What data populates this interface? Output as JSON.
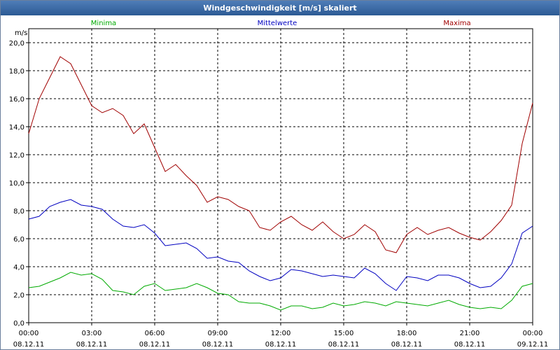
{
  "window": {
    "title": "Windgeschwindigkeit [m/s] skaliert"
  },
  "chart_data": {
    "type": "line",
    "title": "Windgeschwindigkeit [m/s] skaliert",
    "ylabel": "m/s",
    "ylim": [
      0,
      21
    ],
    "xlim": [
      0,
      24
    ],
    "grid": true,
    "y_ticks": [
      "0,0",
      "2,0",
      "4,0",
      "6,0",
      "8,0",
      "10,0",
      "12,0",
      "14,0",
      "16,0",
      "18,0",
      "20,0"
    ],
    "y_tick_values": [
      0,
      2,
      4,
      6,
      8,
      10,
      12,
      14,
      16,
      18,
      20
    ],
    "x_ticks": [
      {
        "time": "00:00",
        "date": "08.12.11"
      },
      {
        "time": "03:00",
        "date": "08.12.11"
      },
      {
        "time": "06:00",
        "date": "08.12.11"
      },
      {
        "time": "09:00",
        "date": "08.12.11"
      },
      {
        "time": "12:00",
        "date": "08.12.11"
      },
      {
        "time": "15:00",
        "date": "08.12.11"
      },
      {
        "time": "18:00",
        "date": "08.12.11"
      },
      {
        "time": "21:00",
        "date": "08.12.11"
      },
      {
        "time": "00:00",
        "date": "09.12.11"
      }
    ],
    "x_tick_values": [
      0,
      3,
      6,
      9,
      12,
      15,
      18,
      21,
      24
    ],
    "legend_position": "top",
    "series": [
      {
        "name": "Minima",
        "color": "#00aa00",
        "x": [
          0,
          0.5,
          1,
          1.5,
          2,
          2.5,
          3,
          3.5,
          4,
          4.5,
          5,
          5.5,
          6,
          6.5,
          7,
          7.5,
          8,
          8.5,
          9,
          9.5,
          10,
          10.5,
          11,
          11.5,
          12,
          12.5,
          13,
          13.5,
          14,
          14.5,
          15,
          15.5,
          16,
          16.5,
          17,
          17.5,
          18,
          18.5,
          19,
          19.5,
          20,
          20.5,
          21,
          21.5,
          22,
          22.5,
          23,
          23.5,
          24
        ],
        "values": [
          2.5,
          2.6,
          2.9,
          3.2,
          3.6,
          3.4,
          3.5,
          3.1,
          2.3,
          2.2,
          2.0,
          2.6,
          2.8,
          2.3,
          2.4,
          2.5,
          2.8,
          2.5,
          2.1,
          2.0,
          1.5,
          1.4,
          1.4,
          1.2,
          0.9,
          1.2,
          1.2,
          1.0,
          1.1,
          1.4,
          1.2,
          1.3,
          1.5,
          1.4,
          1.2,
          1.5,
          1.4,
          1.3,
          1.2,
          1.4,
          1.6,
          1.3,
          1.1,
          1.0,
          1.1,
          1.0,
          1.6,
          2.6,
          2.8
        ]
      },
      {
        "name": "Mittelwerte",
        "color": "#0000c0",
        "x": [
          0,
          0.5,
          1,
          1.5,
          2,
          2.5,
          3,
          3.5,
          4,
          4.5,
          5,
          5.5,
          6,
          6.5,
          7,
          7.5,
          8,
          8.5,
          9,
          9.5,
          10,
          10.5,
          11,
          11.5,
          12,
          12.5,
          13,
          13.5,
          14,
          14.5,
          15,
          15.5,
          16,
          16.5,
          17,
          17.5,
          18,
          18.5,
          19,
          19.5,
          20,
          20.5,
          21,
          21.5,
          22,
          22.5,
          23,
          23.5,
          24
        ],
        "values": [
          7.4,
          7.6,
          8.3,
          8.6,
          8.8,
          8.4,
          8.3,
          8.1,
          7.4,
          6.9,
          6.8,
          7.0,
          6.4,
          5.5,
          5.6,
          5.7,
          5.3,
          4.6,
          4.7,
          4.4,
          4.3,
          3.7,
          3.3,
          3.0,
          3.2,
          3.8,
          3.7,
          3.5,
          3.3,
          3.4,
          3.3,
          3.2,
          3.9,
          3.5,
          2.8,
          2.3,
          3.3,
          3.2,
          3.0,
          3.4,
          3.4,
          3.2,
          2.8,
          2.5,
          2.6,
          3.2,
          4.2,
          6.4,
          6.9
        ]
      },
      {
        "name": "Maxima",
        "color": "#a00000",
        "x": [
          0,
          0.5,
          1,
          1.5,
          2,
          2.5,
          3,
          3.5,
          4,
          4.5,
          5,
          5.5,
          6,
          6.5,
          7,
          7.5,
          8,
          8.5,
          9,
          9.5,
          10,
          10.5,
          11,
          11.5,
          12,
          12.5,
          13,
          13.5,
          14,
          14.5,
          15,
          15.5,
          16,
          16.5,
          17,
          17.5,
          18,
          18.5,
          19,
          19.5,
          20,
          20.5,
          21,
          21.5,
          22,
          22.5,
          23,
          23.5,
          24
        ],
        "values": [
          13.5,
          16.0,
          17.5,
          19.0,
          18.5,
          17.0,
          15.5,
          15.0,
          15.3,
          14.8,
          13.5,
          14.2,
          12.5,
          10.8,
          11.3,
          10.5,
          9.8,
          8.6,
          9.0,
          8.8,
          8.3,
          8.0,
          6.8,
          6.6,
          7.2,
          7.6,
          7.0,
          6.6,
          7.2,
          6.5,
          6.0,
          6.3,
          7.0,
          6.5,
          5.2,
          5.0,
          6.3,
          6.8,
          6.3,
          6.6,
          6.8,
          6.4,
          6.1,
          5.9,
          6.5,
          7.3,
          8.4,
          12.8,
          15.7
        ]
      }
    ]
  }
}
